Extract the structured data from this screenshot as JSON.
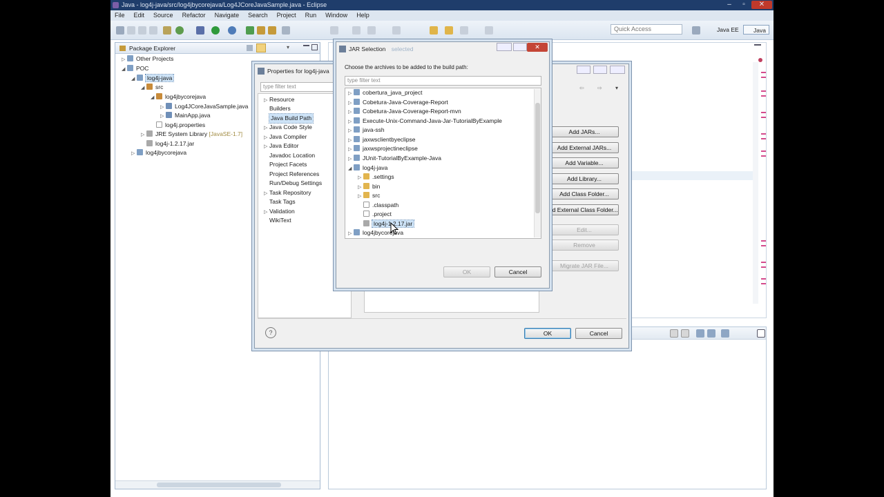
{
  "window": {
    "title": "Java - log4j-java/src/log4jbycorejava/Log4JCoreJavaSample.java - Eclipse",
    "controls": [
      "–",
      "▫",
      "✕"
    ]
  },
  "menu": [
    "File",
    "Edit",
    "Source",
    "Refactor",
    "Navigate",
    "Search",
    "Project",
    "Run",
    "Window",
    "Help"
  ],
  "toolbar": {
    "quick_access_placeholder": "Quick Access",
    "perspectives": [
      "Java EE",
      "Java"
    ]
  },
  "package_explorer": {
    "title": "Package Explorer",
    "items": [
      {
        "label": "Other Projects",
        "suffix": ""
      },
      {
        "label": "POC",
        "suffix": ""
      },
      {
        "label": "log4j-java",
        "suffix": ""
      },
      {
        "label": "src",
        "suffix": ""
      },
      {
        "label": "log4jbycorejava",
        "suffix": ""
      },
      {
        "label": "Log4JCoreJavaSample.java",
        "suffix": ""
      },
      {
        "label": "MainApp.java",
        "suffix": ""
      },
      {
        "label": "log4j.properties",
        "suffix": ""
      },
      {
        "label": "JRE System Library",
        "suffix": "[JavaSE-1.7]"
      },
      {
        "label": "log4j-1.2.17.jar",
        "suffix": ""
      },
      {
        "label": "log4jbycorejava",
        "suffix": ""
      }
    ]
  },
  "properties_dialog": {
    "title": "Properties for log4j-java",
    "filter_placeholder": "type filter text",
    "nav": [
      "Resource",
      "Builders",
      "Java Build Path",
      "Java Code Style",
      "Java Compiler",
      "Java Editor",
      "Javadoc Location",
      "Project Facets",
      "Project References",
      "Run/Debug Settings",
      "Task Repository",
      "Task Tags",
      "Validation",
      "WikiText"
    ],
    "side_buttons": [
      "Add JARs...",
      "Add External JARs...",
      "Add Variable...",
      "Add Library...",
      "Add Class Folder...",
      "Add External Class Folder...",
      "Edit...",
      "Remove",
      "Migrate JAR File..."
    ],
    "ok": "OK",
    "cancel": "Cancel",
    "help": "?"
  },
  "jar_dialog": {
    "title": "JAR Selection",
    "title_extra": "selected",
    "prompt": "Choose the archives to be added to the build path:",
    "filter_placeholder": "type filter text",
    "items": [
      "cobertura_java_project",
      "Cobetura-Java-Coverage-Report",
      "Cobetura-Java-Coverage-Report-mvn",
      "Execute-Unix-Command-Java-Jar-TutorialByExample",
      "java-ssh",
      "jaxwsclientbyeclipse",
      "jaxwsprojectineclipse",
      "JUnit-TutorialByExample-Java",
      "log4j-java",
      ".settings",
      "bin",
      "src",
      ".classpath",
      ".project",
      "log4j-1.2.17.jar",
      "log4jbycorejava"
    ],
    "ok": "OK",
    "cancel": "Cancel"
  }
}
